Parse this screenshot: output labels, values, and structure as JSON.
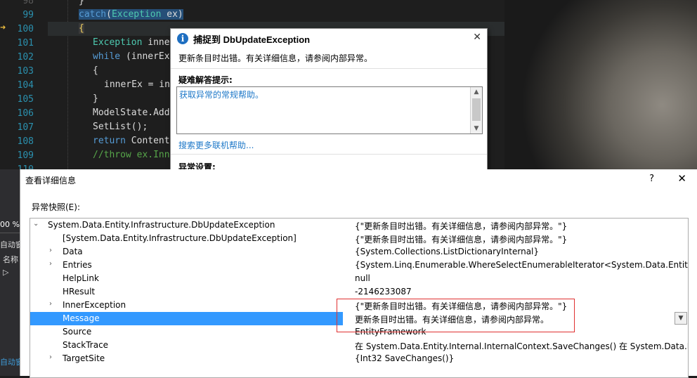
{
  "editor": {
    "lines": [
      {
        "num": "98"
      },
      {
        "num": "99"
      },
      {
        "num": "100"
      },
      {
        "num": "101"
      },
      {
        "num": "102"
      },
      {
        "num": "103"
      },
      {
        "num": "104"
      },
      {
        "num": "105"
      },
      {
        "num": "106"
      },
      {
        "num": "107"
      },
      {
        "num": "108"
      },
      {
        "num": "109"
      },
      {
        "num": "110"
      }
    ],
    "code": {
      "l98": "}",
      "l99_kw": "catch",
      "l99_rest": "(",
      "l99_type": "Exception",
      "l99_tail": " ex)",
      "l100": "{",
      "l101_type": "Exception",
      "l101_rest": " innerEx",
      "l102_kw": "while",
      "l102_rest": " (innerEx.Inne",
      "l103": "{",
      "l104": "innerEx = inner",
      "l105": "}",
      "l106": "ModelState.AddM",
      "l107": "SetList();",
      "l108_kw": "return",
      "l108_rest": " Content(\"<",
      "l109": "//throw ex.InnerEx"
    }
  },
  "popup": {
    "title": "捕捉到 DbUpdateException",
    "message": "更新条目时出错。有关详细信息，请参阅内部异常。",
    "troubleshooting_title": "疑难解答提示:",
    "help_link": "获取异常的常规帮助。",
    "more_help_link": "搜索更多联机帮助...",
    "settings_title": "异常设置:"
  },
  "left_strip": {
    "zoom": "00 %",
    "auto_label": "自动窗",
    "name_label": "名称",
    "bottom_label": "自动窗"
  },
  "dialog": {
    "title": "查看详细信息",
    "help": "?",
    "close": "✕",
    "snapshot_label": "异常快照(E):",
    "rows": [
      {
        "expander": "⌄",
        "name": "System.Data.Entity.Infrastructure.DbUpdateException",
        "value": "{\"更新条目时出错。有关详细信息，请参阅内部异常。\"}"
      },
      {
        "expander": "",
        "name": "[System.Data.Entity.Infrastructure.DbUpdateException]",
        "value": "{\"更新条目时出错。有关详细信息，请参阅内部异常。\"}"
      },
      {
        "expander": "›",
        "name": "Data",
        "value": "{System.Collections.ListDictionaryInternal}"
      },
      {
        "expander": "›",
        "name": "Entries",
        "value": "{System.Linq.Enumerable.WhereSelectEnumerableIterator<System.Data.Entity.Core"
      },
      {
        "expander": "",
        "name": "HelpLink",
        "value": "null"
      },
      {
        "expander": "",
        "name": "HResult",
        "value": "-2146233087"
      },
      {
        "expander": "›",
        "name": "InnerException",
        "value": "{\"更新条目时出错。有关详细信息，请参阅内部异常。\"}"
      },
      {
        "expander": "",
        "name": "Message",
        "value": "更新条目时出错。有关详细信息，请参阅内部异常。"
      },
      {
        "expander": "",
        "name": "Source",
        "value": "EntityFramework"
      },
      {
        "expander": "",
        "name": "StackTrace",
        "value": "   在 System.Data.Entity.Internal.InternalContext.SaveChanges()   在 System.Data.En"
      },
      {
        "expander": "›",
        "name": "TargetSite",
        "value": "{Int32 SaveChanges()}"
      }
    ]
  },
  "colors": {
    "editor_bg": "#1e1e1e",
    "keyword": "#569cd6",
    "type": "#4ec9b0",
    "comment": "#57a64a",
    "line_number": "#2b91af",
    "selection": "#3399ff",
    "highlight_box": "#e03030"
  }
}
